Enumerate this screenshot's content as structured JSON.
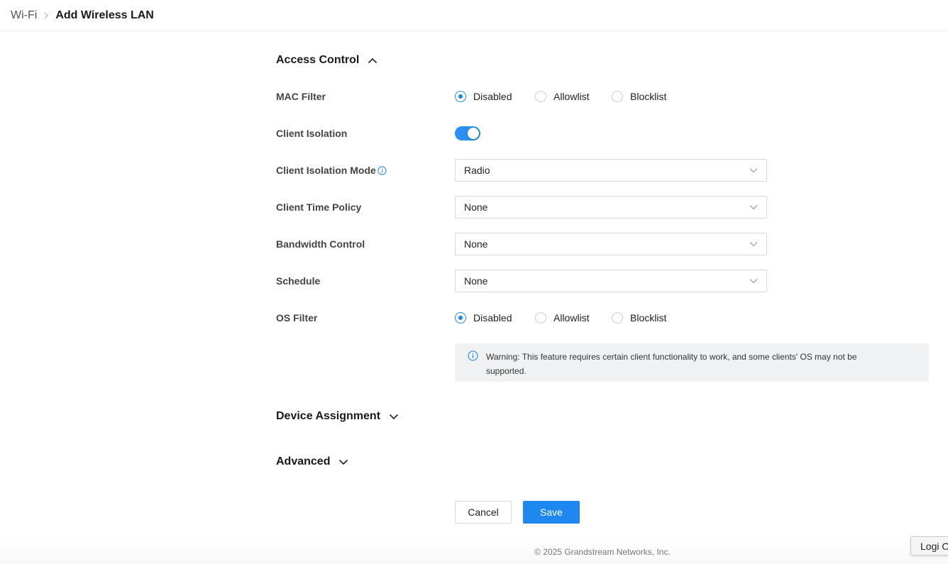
{
  "breadcrumb": {
    "parent": "Wi-Fi",
    "current": "Add Wireless LAN"
  },
  "sections": {
    "access_control": {
      "title": "Access Control",
      "state": "expanded"
    },
    "device_assignment": {
      "title": "Device Assignment",
      "state": "collapsed"
    },
    "advanced": {
      "title": "Advanced",
      "state": "collapsed"
    }
  },
  "form": {
    "mac_filter": {
      "label": "MAC Filter",
      "options": [
        "Disabled",
        "Allowlist",
        "Blocklist"
      ],
      "selected": "Disabled"
    },
    "client_isolation": {
      "label": "Client Isolation",
      "enabled": true
    },
    "client_isolation_mode": {
      "label": "Client Isolation Mode",
      "value": "Radio"
    },
    "client_time_policy": {
      "label": "Client Time Policy",
      "value": "None"
    },
    "bandwidth_control": {
      "label": "Bandwidth Control",
      "value": "None"
    },
    "schedule": {
      "label": "Schedule",
      "value": "None"
    },
    "os_filter": {
      "label": "OS Filter",
      "options": [
        "Disabled",
        "Allowlist",
        "Blocklist"
      ],
      "selected": "Disabled"
    }
  },
  "warning": {
    "text": "Warning: This feature requires certain client functionality to work, and some clients' OS may not be supported."
  },
  "buttons": {
    "cancel": "Cancel",
    "save": "Save"
  },
  "footer": {
    "copyright": "© 2025 Grandstream Networks, Inc."
  },
  "floating_button": {
    "label": "Logi O"
  },
  "colors": {
    "accent": "#1e88f0",
    "warning_bg": "#f0f1f3"
  },
  "icons": [
    "chevron-right-icon",
    "chevron-up-icon",
    "chevron-down-icon",
    "info-icon",
    "dropdown-arrow-icon"
  ]
}
